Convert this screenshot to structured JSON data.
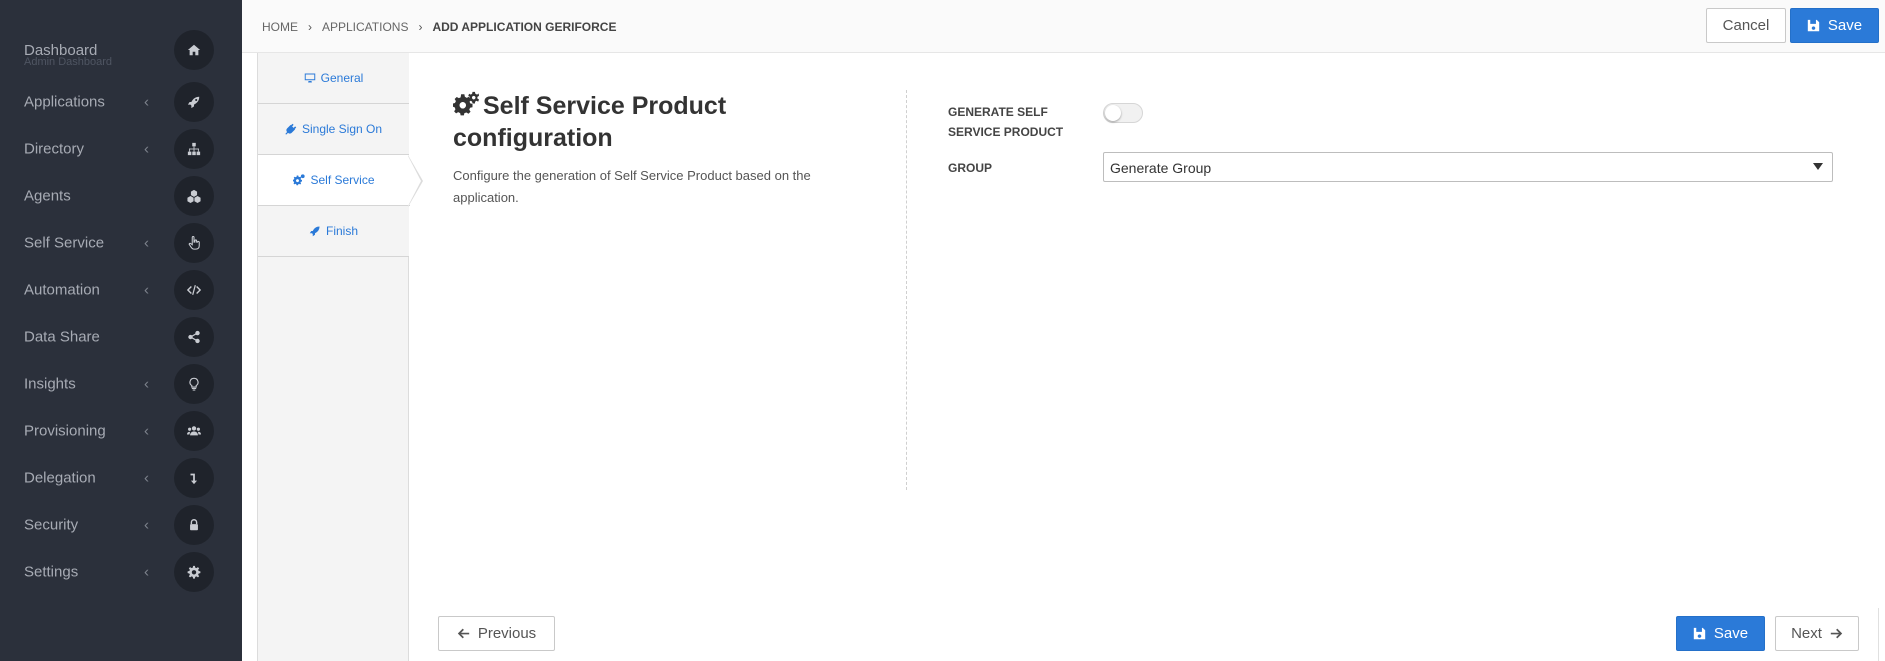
{
  "sidebar": {
    "items": [
      {
        "label": "Dashboard",
        "sublabel": "Admin Dashboard",
        "chevron": "",
        "icon": "home-icon"
      },
      {
        "label": "Applications",
        "chevron": "‹",
        "icon": "rocket-icon"
      },
      {
        "label": "Directory",
        "chevron": "‹",
        "icon": "sitemap-icon"
      },
      {
        "label": "Agents",
        "chevron": "",
        "icon": "cubes-icon"
      },
      {
        "label": "Self Service",
        "chevron": "‹",
        "icon": "hand-pointer-icon"
      },
      {
        "label": "Automation",
        "chevron": "‹",
        "icon": "code-icon"
      },
      {
        "label": "Data Share",
        "chevron": "",
        "icon": "share-icon"
      },
      {
        "label": "Insights",
        "chevron": "‹",
        "icon": "lightbulb-icon"
      },
      {
        "label": "Provisioning",
        "chevron": "‹",
        "icon": "users-icon"
      },
      {
        "label": "Delegation",
        "chevron": "‹",
        "icon": "level-down-icon"
      },
      {
        "label": "Security",
        "chevron": "‹",
        "icon": "lock-icon"
      },
      {
        "label": "Settings",
        "chevron": "‹",
        "icon": "gear-icon"
      }
    ]
  },
  "breadcrumb": {
    "items": [
      "HOME",
      "APPLICATIONS",
      "ADD APPLICATION GERIFORCE"
    ],
    "separator": "›"
  },
  "header": {
    "cancel_label": "Cancel",
    "save_label": "Save"
  },
  "wizard": {
    "tabs": [
      {
        "label": "General",
        "icon": "desktop-icon",
        "active": false
      },
      {
        "label": "Single Sign On",
        "icon": "plug-icon",
        "active": false
      },
      {
        "label": "Self Service",
        "icon": "gears-icon",
        "active": true
      },
      {
        "label": "Finish",
        "icon": "rocket-icon",
        "active": false
      }
    ]
  },
  "section": {
    "title": "Self Service Product configuration",
    "description": "Configure the generation of Self Service Product based on the application."
  },
  "form": {
    "generate_label": "GENERATE SELF SERVICE PRODUCT",
    "generate_value": false,
    "group_label": "GROUP",
    "group_value": "Generate Group"
  },
  "footer": {
    "previous_label": "Previous",
    "save_label": "Save",
    "next_label": "Next"
  },
  "colors": {
    "sidebar_bg": "#2b303b",
    "primary": "#2b7ad8",
    "link": "#2b7ad8"
  }
}
